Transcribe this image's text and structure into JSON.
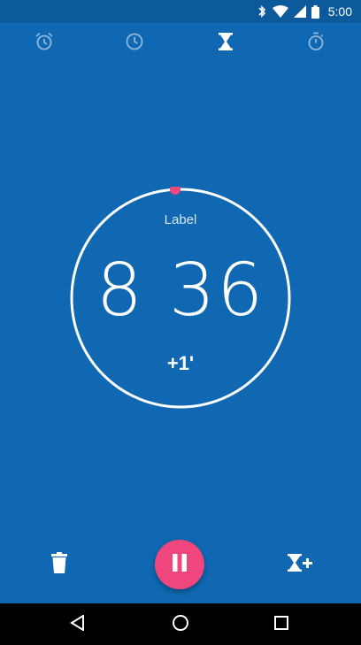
{
  "status_bar": {
    "time": "5:00"
  },
  "tabs": [
    {
      "icon": "alarm-icon",
      "selected": false
    },
    {
      "icon": "clock-icon",
      "selected": false
    },
    {
      "icon": "hourglass-icon",
      "selected": true
    },
    {
      "icon": "stopwatch-icon",
      "selected": false
    }
  ],
  "timer": {
    "label": "Label",
    "time": "8 36",
    "add_minute": "+1'"
  },
  "controls": {
    "delete_icon": "trash-icon",
    "pause_icon": "pause-icon",
    "add_timer_icon": "hourglass-plus-icon"
  },
  "colors": {
    "background": "#0f68b1",
    "status_bar": "#0c5a9b",
    "accent": "#f0467e"
  }
}
